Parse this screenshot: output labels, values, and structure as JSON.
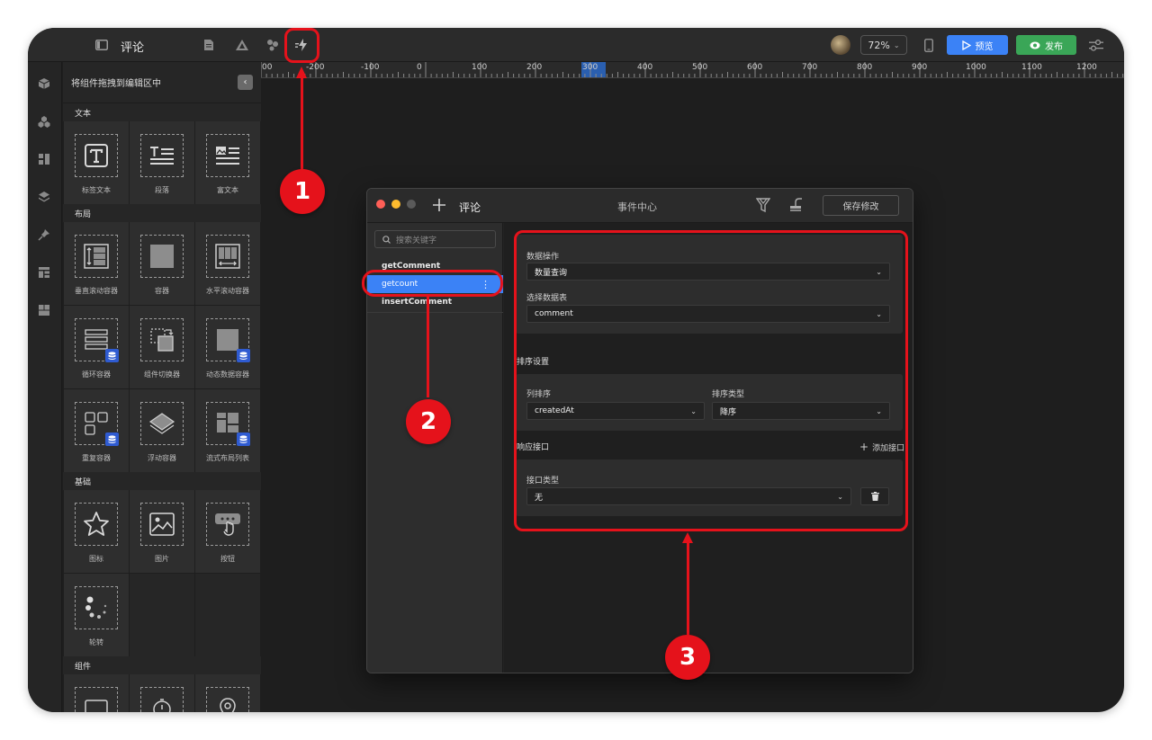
{
  "app": {
    "title": "评论",
    "zoom": "72%",
    "preview_label": "预览",
    "publish_label": "发布"
  },
  "component_panel": {
    "heading": "将组件拖拽到编辑区中",
    "sections": [
      {
        "title": "文本",
        "items": [
          {
            "label": "标签文本",
            "icon": "text-icon"
          },
          {
            "label": "段落",
            "icon": "paragraph-icon"
          },
          {
            "label": "富文本",
            "icon": "rich-text-icon"
          }
        ]
      },
      {
        "title": "布局",
        "items": [
          {
            "label": "垂直滚动容器",
            "icon": "vertical-scroll-icon"
          },
          {
            "label": "容器",
            "icon": "container-icon"
          },
          {
            "label": "水平滚动容器",
            "icon": "horizontal-scroll-icon"
          },
          {
            "label": "循环容器",
            "icon": "loop-container-icon"
          },
          {
            "label": "组件切换器",
            "icon": "switcher-icon"
          },
          {
            "label": "动态数据容器",
            "icon": "dynamic-data-icon"
          },
          {
            "label": "重复容器",
            "icon": "repeat-container-icon"
          },
          {
            "label": "浮动容器",
            "icon": "floating-container-icon"
          },
          {
            "label": "流式布局列表",
            "icon": "flow-list-icon"
          }
        ]
      },
      {
        "title": "基础",
        "items": [
          {
            "label": "图标",
            "icon": "star-icon"
          },
          {
            "label": "图片",
            "icon": "image-icon"
          },
          {
            "label": "按钮",
            "icon": "button-icon"
          },
          {
            "label": "轮转",
            "icon": "carousel-icon"
          }
        ]
      },
      {
        "title": "组件",
        "items": []
      }
    ]
  },
  "ruler": {
    "labels": [
      "00",
      "-200",
      "-100",
      "0",
      "100",
      "200",
      "300",
      "400",
      "500",
      "600",
      "700",
      "800",
      "900",
      "1000",
      "1100",
      "1200"
    ]
  },
  "event_center": {
    "doc_title": "评论",
    "title": "事件中心",
    "save_label": "保存修改",
    "search_placeholder": "搜索关键字",
    "events": [
      "getComment",
      "getcount",
      "insertComment"
    ],
    "selected_event": "getcount",
    "data_op_label": "数据操作",
    "data_op_value": "数量查询",
    "table_label": "选择数据表",
    "table_value": "comment",
    "sort_section": "排序设置",
    "sort_col_label": "列排序",
    "sort_col_value": "createdAt",
    "sort_type_label": "排序类型",
    "sort_type_value": "降序",
    "resp_section": "响应接口",
    "add_api_label": "添加接口",
    "api_type_label": "接口类型",
    "api_type_value": "无"
  },
  "annotations": {
    "step1": "1",
    "step2": "2",
    "step3": "3",
    "color": "#e5121b"
  },
  "colors": {
    "accent_blue": "#3b82f6",
    "publish_green": "#3aa657"
  }
}
